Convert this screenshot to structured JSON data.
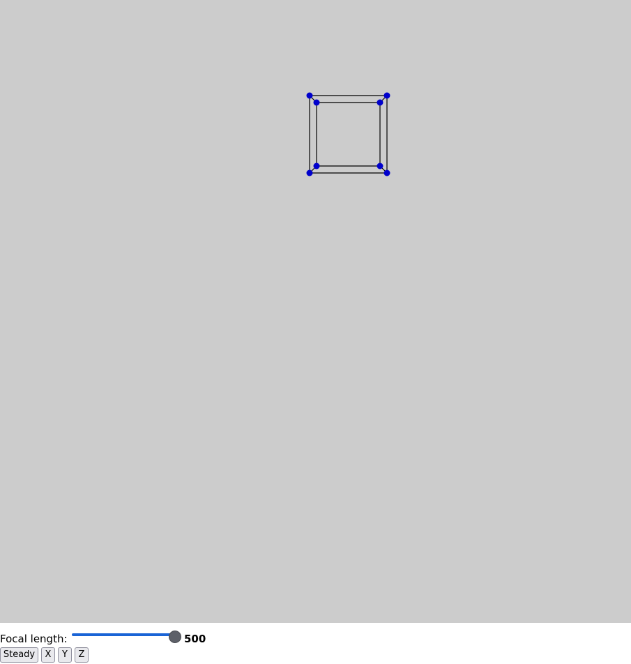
{
  "scene": {
    "background_color": "#cccccc",
    "edge_color": "#000000",
    "vertex_color": "#0000cc"
  },
  "controls": {
    "focal_label": "Focal length:",
    "focal_value": "500",
    "slider_fraction": 1.0,
    "slider_color": "#1a64d6",
    "buttons": {
      "steady": "Steady",
      "x": "X",
      "y": "Y",
      "z": "Z"
    }
  }
}
